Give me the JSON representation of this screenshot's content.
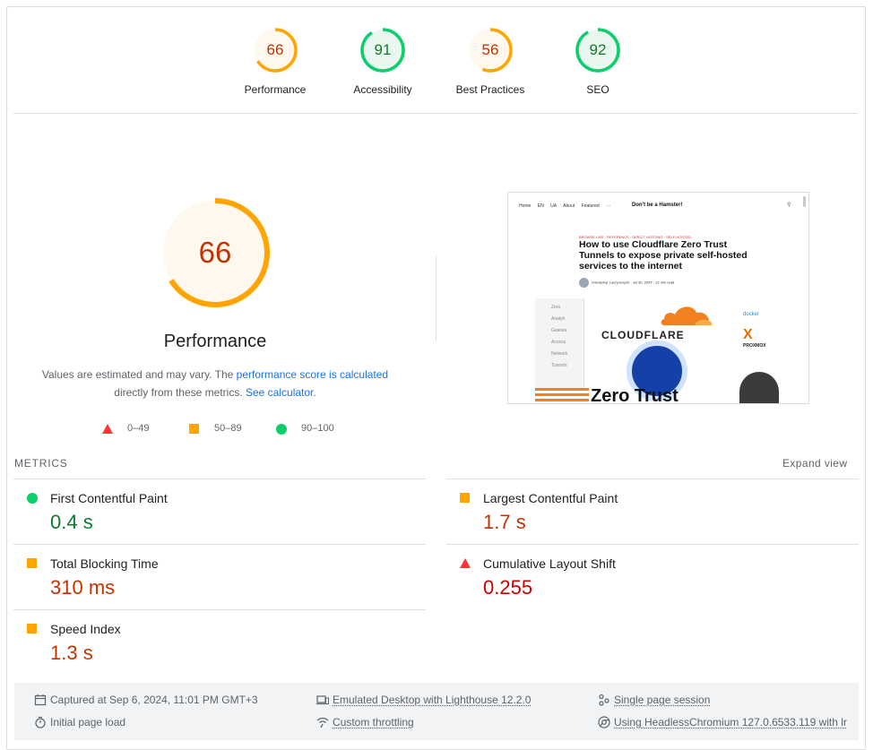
{
  "scores": [
    {
      "label": "Performance",
      "value": "66",
      "pct": 0.66,
      "color": "#ffa400",
      "text_color": "#c33300",
      "bg": "#fff8ef"
    },
    {
      "label": "Accessibility",
      "value": "91",
      "pct": 0.91,
      "color": "#0cce6b",
      "text_color": "#0d7c2d",
      "bg": "#e9f7ef"
    },
    {
      "label": "Best Practices",
      "value": "56",
      "pct": 0.56,
      "color": "#ffa400",
      "text_color": "#c33300",
      "bg": "#fff8ef"
    },
    {
      "label": "SEO",
      "value": "92",
      "pct": 0.92,
      "color": "#0cce6b",
      "text_color": "#0d7c2d",
      "bg": "#e9f7ef"
    }
  ],
  "performance": {
    "score": "66",
    "title": "Performance",
    "desc_prefix": "Values are estimated and may vary. The ",
    "desc_link": "performance score is calculated",
    "desc_suffix": "directly from these metrics.",
    "calc_link": "See calculator."
  },
  "legend": [
    {
      "shape": "triangle",
      "color": "#ff3333",
      "range": "0–49"
    },
    {
      "shape": "square",
      "color": "#ffa400",
      "range": "50–89"
    },
    {
      "shape": "circle",
      "color": "#0cce6b",
      "range": "90–100"
    }
  ],
  "screenshot": {
    "nav": [
      "Home",
      "EN",
      "UA",
      "About",
      "Featured",
      "···"
    ],
    "brand": "Don't be a Hamster!",
    "kicker": "BROWSE LIBS · REFERENCE · DIRECT HOSTING · SELF-HOSTED",
    "headline": "How to use Cloudflare Zero Trust Tunnels to expose private self-hosted services to the internet",
    "author": "Volodymyr Lavrynovych",
    "author_meta": "Jul 30, 2024 · 12 min read",
    "sidebar": [
      "Zero",
      "Analyti",
      "Gatewa",
      "Access",
      "Network",
      "Tunnels"
    ],
    "cloudflare": "CLOUDFLARE",
    "docker": "docker",
    "proxmox_logo": "X",
    "proxmox": "PROXMOX",
    "zero_trust": "Zero Trust"
  },
  "metrics": {
    "header": "METRICS",
    "expand": "Expand view",
    "items": [
      {
        "name": "first-contentful-paint",
        "title": "First Contentful Paint",
        "value": "0.4 s",
        "status": "green"
      },
      {
        "name": "largest-contentful-paint",
        "title": "Largest Contentful Paint",
        "value": "1.7 s",
        "status": "orange"
      },
      {
        "name": "total-blocking-time",
        "title": "Total Blocking Time",
        "value": "310 ms",
        "status": "orange"
      },
      {
        "name": "cumulative-layout-shift",
        "title": "Cumulative Layout Shift",
        "value": "0.255",
        "status": "red"
      },
      {
        "name": "speed-index",
        "title": "Speed Index",
        "value": "1.3 s",
        "status": "orange"
      }
    ]
  },
  "footer": {
    "captured": "Captured at Sep 6, 2024, 11:01 PM GMT+3",
    "emulated": "Emulated Desktop with Lighthouse 12.2.0",
    "session": "Single page session",
    "load": "Initial page load",
    "throttling": "Custom throttling",
    "browser": "Using HeadlessChromium 127.0.6533.119 with lr"
  },
  "colors": {
    "pass": "#0cce6b",
    "average": "#ffa400",
    "fail": "#ff3333",
    "link": "#1a73e8"
  }
}
